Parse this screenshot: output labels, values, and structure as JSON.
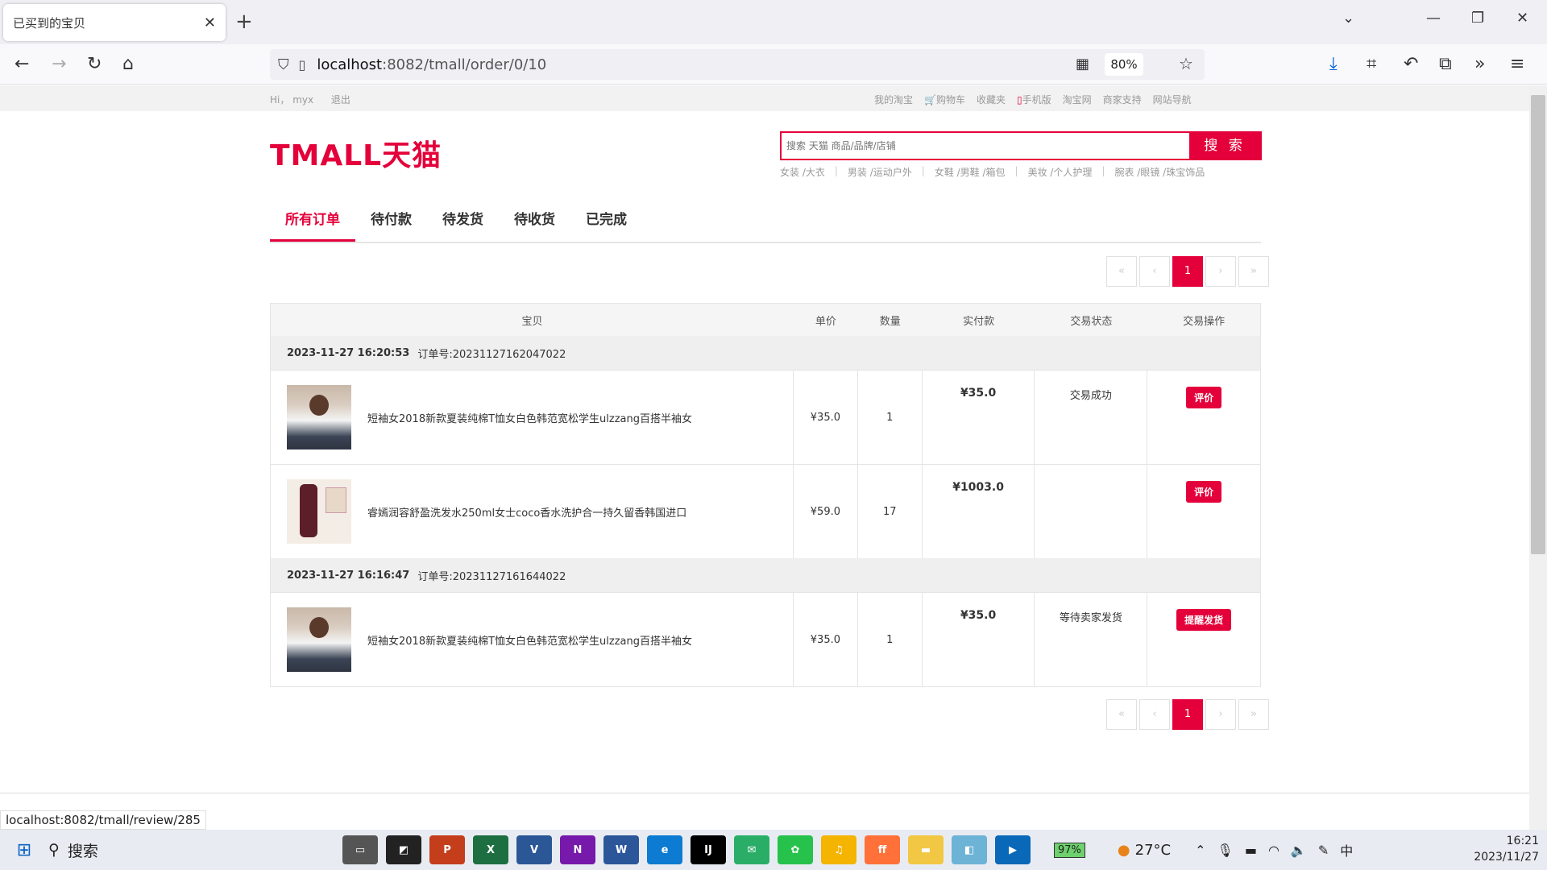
{
  "browser": {
    "tab_title": "已买到的宝贝",
    "tab_close": "✕",
    "new_tab": "+",
    "url_host": "localhost",
    "url_path": ":8082/tmall/order/0/10",
    "zoom": "80%",
    "status_url": "localhost:8082/tmall/review/285"
  },
  "topnav": {
    "greeting": "Hi，",
    "user": "myx",
    "logout": "退出",
    "links": [
      "我的淘宝",
      "购物车",
      "收藏夹",
      "手机版",
      "淘宝网",
      "商家支持",
      "网站导航"
    ]
  },
  "logo": "TMALL天猫",
  "search": {
    "placeholder": "搜索 天猫 商品/品牌/店铺",
    "button": "搜 索",
    "hot": [
      "女装 /大衣",
      "男装 /运动户外",
      "女鞋 /男鞋 /箱包",
      "美妆 /个人护理",
      "腕表 /眼镜 /珠宝饰品"
    ]
  },
  "tabs": [
    "所有订单",
    "待付款",
    "待发货",
    "待收货",
    "已完成"
  ],
  "pager": {
    "first": "«",
    "prev": "‹",
    "current": "1",
    "next": "›",
    "last": "»"
  },
  "table_headers": [
    "宝贝",
    "单价",
    "数量",
    "实付款",
    "交易状态",
    "交易操作"
  ],
  "orders": [
    {
      "time": "2023-11-27 16:20:53",
      "order_no": "订单号:20231127162047022",
      "status": "交易成功",
      "items": [
        {
          "title": "短袖女2018新款夏装纯棉T恤女白色韩范宽松学生ulzzang百搭半袖女",
          "price": "¥35.0",
          "qty": "1",
          "paid": "¥35.0",
          "action": "评价"
        },
        {
          "title": "睿嫣润容舒盈洗发水250ml女士coco香水洗护合一持久留香韩国进口",
          "price": "¥59.0",
          "qty": "17",
          "paid": "¥1003.0",
          "action": "评价"
        }
      ]
    },
    {
      "time": "2023-11-27 16:16:47",
      "order_no": "订单号:20231127161644022",
      "status": "等待卖家发货",
      "items": [
        {
          "title": "短袖女2018新款夏装纯棉T恤女白色韩范宽松学生ulzzang百搭半袖女",
          "price": "¥35.0",
          "qty": "1",
          "paid": "¥35.0",
          "action": "提醒发货"
        }
      ]
    }
  ],
  "taskbar": {
    "search": "搜索",
    "battery": "97%",
    "weather": "27°C",
    "time": "16:21",
    "date": "2023/11/27",
    "ime": "中"
  },
  "colors": {
    "accent": "#e4003a"
  }
}
